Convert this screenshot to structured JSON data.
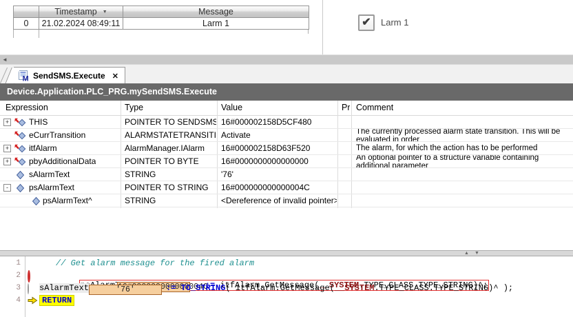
{
  "alarm_table": {
    "columns": {
      "index": "",
      "timestamp": "Timestamp",
      "message": "Message"
    },
    "sort_icon": "▼",
    "rows": [
      {
        "index": "0",
        "timestamp": "21.02.2024 08:49:11",
        "message": "Larm 1"
      }
    ]
  },
  "viz": {
    "checkbox_label": "Larm 1",
    "checkbox_glyph": "✔"
  },
  "scrollbar": {
    "left_arrow": "◄"
  },
  "tab": {
    "label": "SendSMS.Execute",
    "close_glyph": "✕"
  },
  "breadcrumb": {
    "path": "Device.Application.PLC_PRG.mySendSMS.Execute"
  },
  "watch": {
    "headers": {
      "expression": "Expression",
      "type": "Type",
      "value": "Value",
      "prepared": "Prepared value",
      "comment": "Comment"
    },
    "rows": [
      {
        "expand": "+",
        "expression": "THIS",
        "type": "POINTER TO SENDSMS",
        "value": "16#000002158D5CF480",
        "comment": ""
      },
      {
        "expand": "",
        "expression": "eCurrTransition",
        "type": "ALARMSTATETRANSITION",
        "value": "Activate",
        "comment": "The currently processed alarm state transition. This will be evaluated in order"
      },
      {
        "expand": "+",
        "expression": "itfAlarm",
        "type": "AlarmManager.IAlarm",
        "value": "16#000002158D63F520",
        "comment": "The alarm, for which the action has to be performed"
      },
      {
        "expand": "+",
        "expression": "pbyAdditionalData",
        "type": "POINTER TO BYTE",
        "value": "16#0000000000000000",
        "comment": "An optional pointer to a structure variable containing additional parameter"
      },
      {
        "expand": "",
        "expression": "sAlarmText",
        "type": "STRING",
        "value": "'76'",
        "comment": ""
      },
      {
        "expand": "-",
        "expression": "psAlarmText",
        "type": "POINTER TO STRING",
        "value": "16#000000000000004C",
        "comment": ""
      },
      {
        "expand": "",
        "expression": "psAlarmText^",
        "type": "STRING",
        "value": "<Dereference of invalid pointer>",
        "comment": ""
      }
    ]
  },
  "splitter": {
    "up": "▲",
    "down": "▼"
  },
  "code": {
    "line1": {
      "num": "1",
      "comment": "// Get alarm message for the fired alarm"
    },
    "line2": {
      "num": "2",
      "lhs": "psAlarmText",
      "inline_value": "16#000000000000004C",
      "op": ":= ",
      "call": "itfAlarm.GetMessage(",
      "sys": "__SYSTEM",
      "tail": ".TYPE_CLASS.TYPE_STRING)^;"
    },
    "line3": {
      "num": "3",
      "lhs": "sAlarmText",
      "inline_value": "'76'",
      "op": ":= ",
      "fn": "TO_STRING",
      "call": "( itfAlarm.GetMessage(",
      "sys": "__SYSTEM",
      "tail": ".TYPE_CLASS.TYPE_STRING)^ );"
    },
    "line4": {
      "num": "4",
      "keyword": "RETURN"
    }
  },
  "colors": {
    "accent_red": "#cf3030",
    "inline_box_bg": "#f6cf9e",
    "inline_box_border": "#a8652a",
    "highlight_yellow": "#ffff00",
    "keyword_blue": "#0000d4",
    "comment_teal": "#1d8f8f",
    "system_maroon": "#8b1515",
    "titlebar_gray": "#696969"
  }
}
